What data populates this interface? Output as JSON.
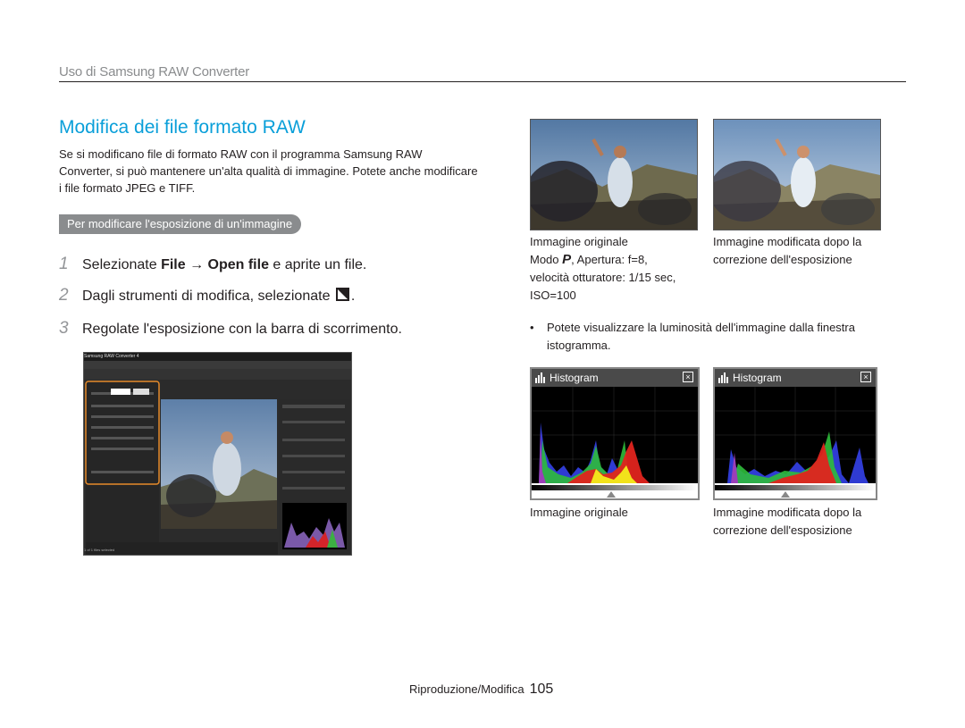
{
  "header": {
    "section": "Uso di Samsung RAW Converter"
  },
  "title": "Modifica dei file formato RAW",
  "intro": "Se si modificano file di formato RAW con il programma Samsung RAW Converter, si può mantenere un'alta qualità di immagine. Potete anche modificare i file formato JPEG e TIFF.",
  "subsection": "Per modificare l'esposizione di un'immagine",
  "steps": [
    {
      "num": "1",
      "pre": "Selezionate ",
      "b1": "File",
      "arrow": " → ",
      "b2": "Open file",
      "post": " e aprite un file."
    },
    {
      "num": "2",
      "pre": "Dagli strumenti di modifica, selezionate ",
      "post": "."
    },
    {
      "num": "3",
      "text": "Regolate l'esposizione con la barra di scorrimento."
    }
  ],
  "screenshot": {
    "title": "Samsung RAW Converter 4",
    "menu": [
      "File(F)",
      "Edit(E)",
      "Compare(C)",
      "View(V)",
      "Tools(T)",
      "Developments(D)",
      "Option(O)",
      "Help(H)"
    ],
    "exposure_label": "Exposure",
    "exposure_value_1": "-0.86",
    "exposure_value_2": "+0.00",
    "status": "1 of 1 files selected"
  },
  "photo_captions": {
    "left_title": "Immagine originale",
    "left_line2_pre": "Modo ",
    "left_mode": "P",
    "left_line2_post": ", Apertura: f=8,",
    "left_line3": "velocità otturatore: 1/15 sec,",
    "left_line4": "ISO=100",
    "right_line1": "Immagine modificata dopo la",
    "right_line2": "correzione dell'esposizione"
  },
  "bullet": "Potete visualizzare la luminosità dell'immagine dalla finestra istogramma.",
  "histograms": [
    {
      "title": "Histogram"
    },
    {
      "title": "Histogram"
    }
  ],
  "hist_captions": {
    "left": "Immagine originale",
    "right_line1": "Immagine modificata dopo la",
    "right_line2": "correzione dell'esposizione"
  },
  "footer": {
    "label": "Riproduzione/Modifica",
    "page": "105"
  },
  "colors": {
    "title": "#0a9fd9",
    "pill": "#8a8c8e",
    "step_num": "#939598"
  }
}
